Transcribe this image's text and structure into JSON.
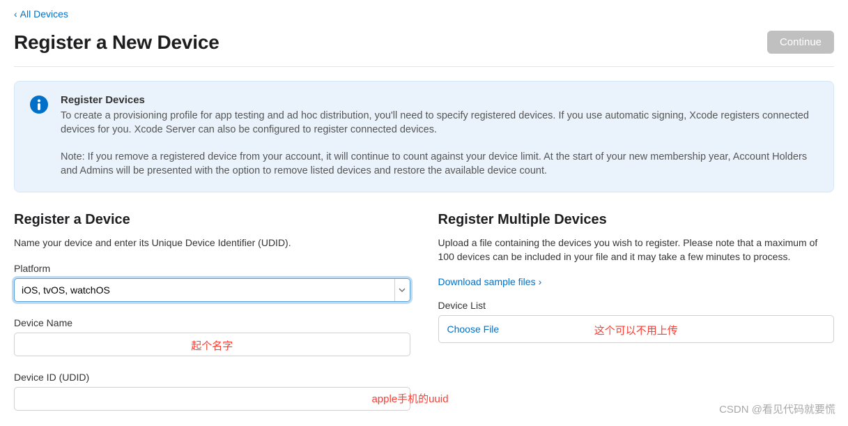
{
  "back_link": {
    "label": "All Devices"
  },
  "header": {
    "title": "Register a New Device",
    "continue_label": "Continue"
  },
  "info": {
    "heading": "Register Devices",
    "p1": "To create a provisioning profile for app testing and ad hoc distribution, you'll need to specify registered devices. If you use automatic signing, Xcode registers connected devices for you. Xcode Server can also be configured to register connected devices.",
    "p2": "Note: If you remove a registered device from your account, it will continue to count against your device limit. At the start of your new membership year, Account Holders and Admins will be presented with the option to remove listed devices and restore the available device count."
  },
  "left": {
    "title": "Register a Device",
    "desc": "Name your device and enter its Unique Device Identifier (UDID).",
    "platform_label": "Platform",
    "platform_value": "iOS, tvOS, watchOS",
    "devicename_label": "Device Name",
    "devicename_value": "",
    "deviceid_label": "Device ID (UDID)",
    "deviceid_value": ""
  },
  "right": {
    "title": "Register Multiple Devices",
    "desc": "Upload a file containing the devices you wish to register. Please note that a maximum of 100 devices can be included in your file and it may take a few minutes to process.",
    "download_label": "Download sample files",
    "devicelist_label": "Device List",
    "choose_file": "Choose File"
  },
  "annotations": {
    "name_hint": "起个名字",
    "uuid_hint": "apple手机的uuid",
    "upload_hint": "这个可以不用上传"
  },
  "watermark": "CSDN @看见代码就要慌"
}
